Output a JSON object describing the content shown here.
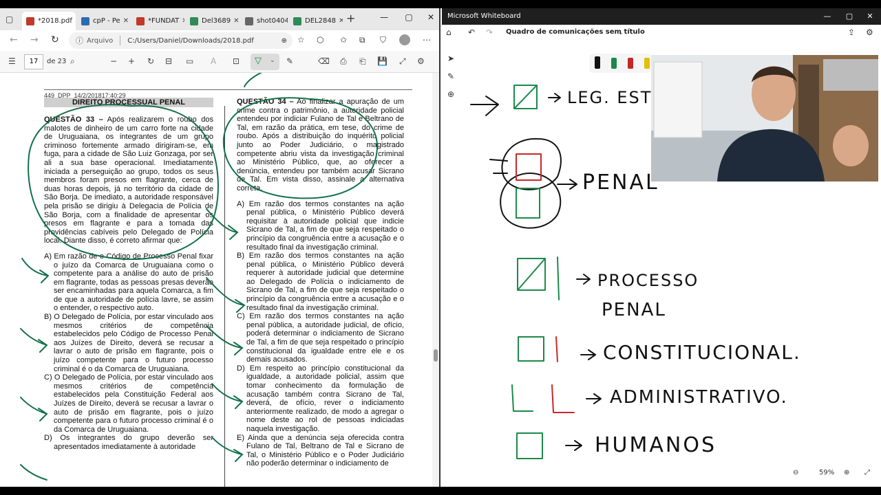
{
  "browser": {
    "tabs": [
      {
        "label": "*2018.pdf",
        "active": true,
        "icon": "pdf-icon",
        "color": "#c0392b"
      },
      {
        "label": "cpP - Pe",
        "icon": "search-icon",
        "color": "#2b6cb0"
      },
      {
        "label": "*FUNDAT",
        "icon": "pdf-icon",
        "color": "#c0392b"
      },
      {
        "label": "Del3689",
        "icon": "flag-icon",
        "color": "#2e8b57"
      },
      {
        "label": "shot0404",
        "icon": "page-icon",
        "color": "#666666"
      },
      {
        "label": "DEL2848",
        "icon": "flag-icon",
        "color": "#2e8b57"
      }
    ],
    "new_tab": "+",
    "url_label": "Arquivo",
    "url": "C:/Users/Daniel/Downloads/2018.pdf"
  },
  "pdf_toolbar": {
    "page_current": "17",
    "page_total": "de 23"
  },
  "document": {
    "header_code": "449_DPP_14/2/201817:40:29",
    "section_title": "DIREITO PROCESSUAL PENAL",
    "q33": {
      "label": "QUESTÃO 33 –",
      "text": "Após realizarem o roubo dos malotes de dinheiro de um carro forte na cidade de Uruguaiana, os integrantes de um grupo criminoso fortemente armado dirigiram-se, em fuga, para a cidade de São Luiz Gonzaga, por ser ali a sua base operacional. Imediatamente iniciada a perseguição ao grupo, todos os seus membros foram presos em flagrante, cerca de duas horas depois, já no território da cidade de São Borja. De imediato, a autoridade responsável pela prisão se dirigiu à Delegacia de Polícia de São Borja, com a finalidade de apresentar os presos em flagrante e para a tomada das providências cabíveis pelo Delegado de Polícia local. Diante disso, é correto afirmar que:",
      "options": [
        "A) Em razão de o Código de Processo Penal fixar o juízo da Comarca de Uruguaiana como o competente para a análise do auto de prisão em flagrante, todas as pessoas presas deverão ser encaminhadas para aquela Comarca, a fim de que a autoridade de polícia lavre, se assim o entender, o respectivo auto.",
        "B) O Delegado de Polícia, por estar vinculado aos mesmos critérios de competência estabelecidos pelo Código de Processo Penal aos Juízes de Direito, deverá se recusar a lavrar o auto de prisão em flagrante, pois o juízo competente para o futuro processo criminal é o da Comarca de Uruguaiana.",
        "C) O Delegado de Polícia, por estar vinculado aos mesmos critérios de competência estabelecidos pela Constituição Federal aos Juízes de Direito, deverá se recusar a lavrar o auto de prisão em flagrante, pois o juízo competente para o futuro processo criminal é o da Comarca de Uruguaiana.",
        "D) Os integrantes do grupo deverão ser apresentados imediatamente à autoridade"
      ]
    },
    "q34": {
      "label": "QUESTÃO 34 –",
      "text": "Ao finalizar a apuração de um crime contra o patrimônio, a autoridade policial entendeu por indiciar Fulano de Tal e Beltrano de Tal, em razão da prática, em tese, do crime de roubo. Após a distribuição do inquérito policial junto ao Poder Judiciário, o magistrado competente abriu vista da investigação criminal ao Ministério Público, que, ao oferecer a denúncia, entendeu por também acusar Sicrano de Tal. Em vista disso, assinale a alternativa correta.",
      "options": [
        "A) Em razão dos termos constantes na ação penal pública, o Ministério Público deverá requisitar à autoridade policial que indicie Sicrano de Tal, a fim de que seja respeitado o princípio da congruência entre a acusação e o resultado final da investigação criminal.",
        "B) Em razão dos termos constantes na ação penal pública, o Ministério Público deverá requerer à autoridade judicial que determine ao Delegado de Polícia o indiciamento de Sicrano de Tal, a fim de que seja respeitado o princípio da congruência entre a acusação e o resultado final da investigação criminal.",
        "C) Em razão dos termos constantes na ação penal pública, a autoridade judicial, de ofício, poderá determinar o indiciamento de Sicrano de Tal, a fim de que seja respeitado o princípio constitucional da igualdade entre ele e os demais acusados.",
        "D) Em respeito ao princípio constitucional da igualdade, a autoridade policial, assim que tomar conhecimento da formulação de acusação também contra Sicrano de Tal, deverá, de ofício, rever o indiciamento anteriormente realizado, de modo a agregar o nome deste ao rol de pessoas indiciadas naquela investigação.",
        "E) Ainda que a denúncia seja oferecida contra Fulano de Tal, Beltrano de Tal e Sicrano de Tal, o Ministério Público e o Poder Judiciário não poderão determinar o indiciamento de"
      ]
    }
  },
  "whiteboard": {
    "app_title": "Microsoft Whiteboard",
    "board_name": "Quadro de comunicações sem título",
    "zoom": "59%",
    "labels": {
      "leg_est": "LEG. EST.",
      "penal": "PENAL",
      "processo": "PROCESSO",
      "processo2": "PENAL",
      "constitucional": "CONSTITUCIONAL.",
      "administrativo": "ADMINISTRATIVO.",
      "humanos": "HUMANOS"
    },
    "colors": {
      "green": "#1a8a4a",
      "red": "#c62828",
      "ink": "#111111",
      "pdf_ink": "#12704a"
    }
  }
}
